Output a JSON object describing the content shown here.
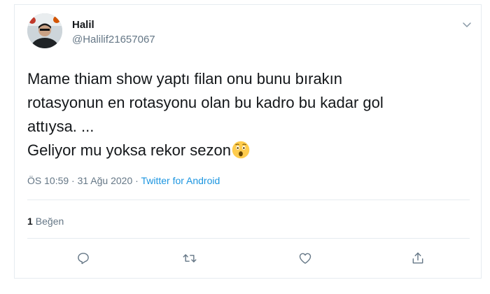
{
  "tweet": {
    "author": {
      "display_name": "Halil",
      "handle": "@Halilif21657067"
    },
    "text": "Mame thiam show yaptı filan onu bunu bırakın\nrotasyonun en rotasyonu olan bu kadro bu kadar gol\nattıysa. ...\nGeliyor mu yoksa rekor sezon",
    "emoji": "astonished-face-emoji",
    "time": "ÖS 10:59",
    "separator": " · ",
    "date": "31 Ağu 2020",
    "source": "Twitter for Android",
    "likes": {
      "count": "1",
      "label": "Beğen"
    }
  },
  "icons": {
    "menu": "chevron-down-icon",
    "reply": "reply-icon",
    "retweet": "retweet-icon",
    "like": "heart-icon",
    "share": "share-icon"
  },
  "colors": {
    "text_primary": "#14171a",
    "text_secondary": "#657786",
    "link": "#1b95e0",
    "border": "#e6ecf0"
  }
}
